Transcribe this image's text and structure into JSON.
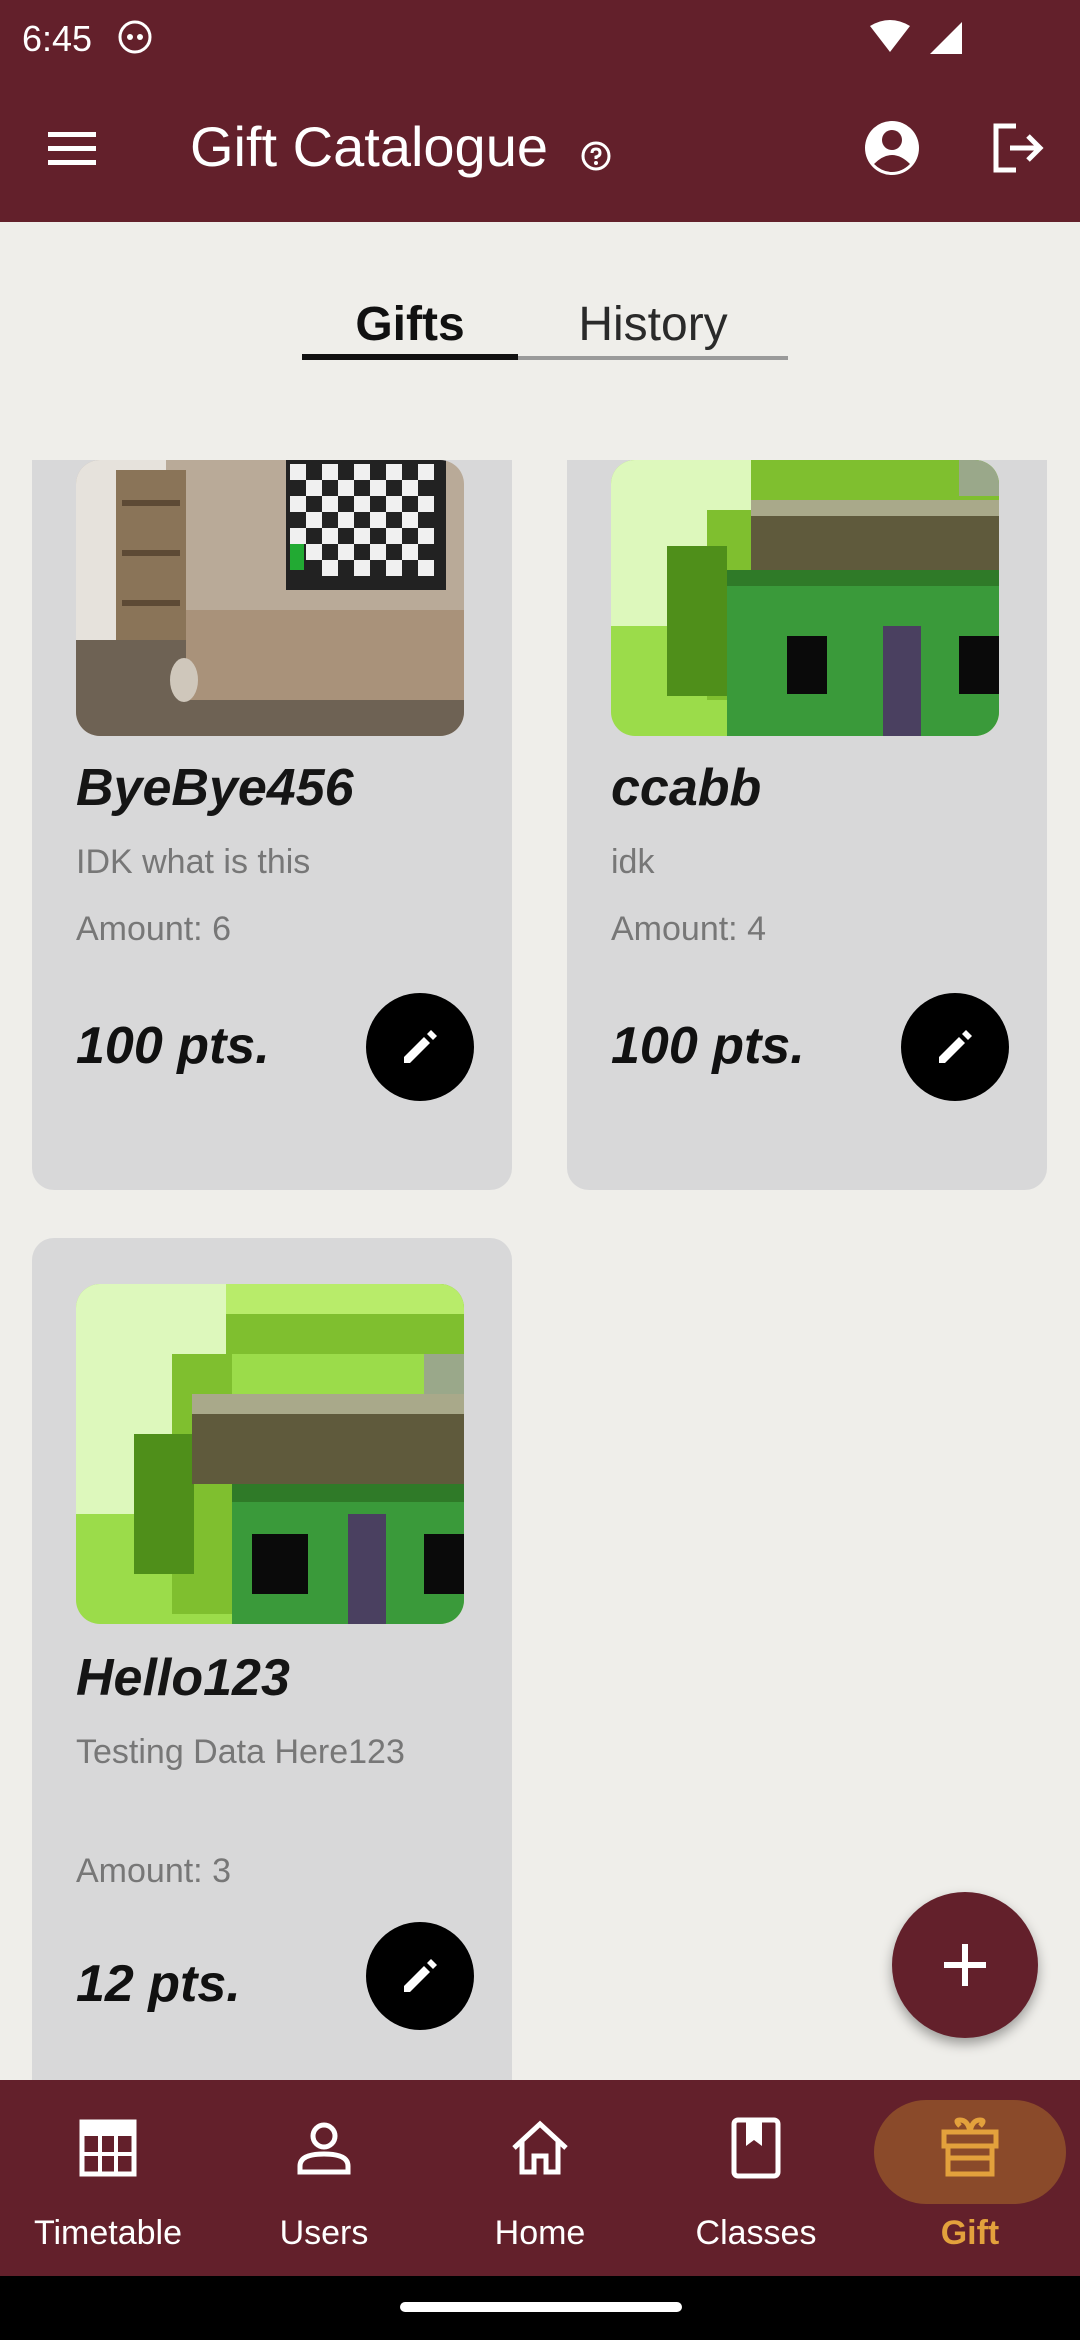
{
  "status_bar": {
    "time": "6:45"
  },
  "app_bar": {
    "title": "Gift Catalogue"
  },
  "tabs": [
    {
      "label": "Gifts",
      "active": true
    },
    {
      "label": "History",
      "active": false
    }
  ],
  "gifts": [
    {
      "name": "ByeBye456",
      "description": "IDK what is this",
      "amount": "Amount: 6",
      "points": "100 pts.",
      "image": "living-room-tv"
    },
    {
      "name": "ccabb",
      "description": "idk",
      "amount": "Amount: 4",
      "points": "100 pts.",
      "image": "pixel-house"
    },
    {
      "name": "Hello123",
      "description": "Testing Data Here123",
      "amount": "Amount: 3",
      "points": "12 pts.",
      "image": "pixel-house"
    }
  ],
  "bottom_nav": [
    {
      "label": "Timetable",
      "icon": "timetable-icon"
    },
    {
      "label": "Users",
      "icon": "users-icon"
    },
    {
      "label": "Home",
      "icon": "home-icon"
    },
    {
      "label": "Classes",
      "icon": "classes-icon"
    },
    {
      "label": "Gift",
      "icon": "gift-icon",
      "active": true
    }
  ],
  "colors": {
    "primary": "#63202b",
    "background": "#efeeea",
    "card": "#d8d8d9",
    "active_nav": "#e3a13c",
    "active_pill": "#8a4a2a"
  }
}
